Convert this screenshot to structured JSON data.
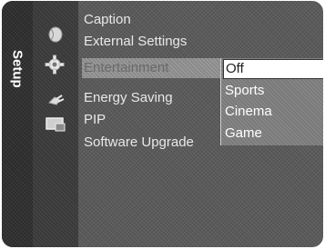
{
  "menu": {
    "tab_label": "Setup",
    "icons": [
      "satellite-icon",
      "gear-icon",
      "plug-icon",
      "monitor-icon"
    ],
    "items": [
      {
        "label": "Caption"
      },
      {
        "label": "External Settings"
      },
      {
        "label": "Entertainment"
      },
      {
        "label": "Energy Saving"
      },
      {
        "label": "PIP"
      },
      {
        "label": "Software Upgrade"
      }
    ],
    "selected_index": 2
  },
  "dropdown": {
    "options": [
      "Off",
      "Sports",
      "Cinema",
      "Game"
    ],
    "highlighted": "Off"
  }
}
